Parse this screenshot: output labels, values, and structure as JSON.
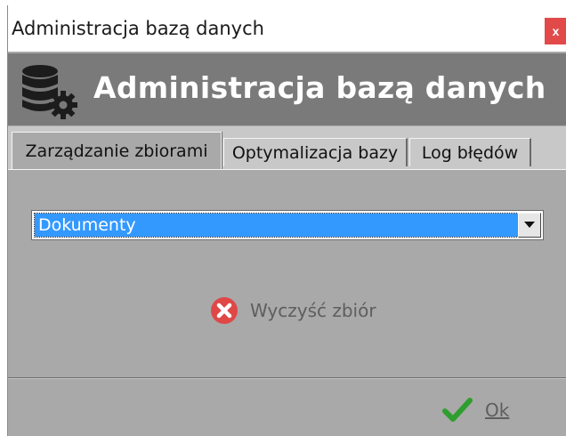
{
  "window": {
    "title": "Administracja bazą danych",
    "close_label": "x"
  },
  "header": {
    "title": "Administracja bazą danych",
    "icon": "database-settings-icon"
  },
  "tabs": [
    {
      "label": "Zarządzanie zbiorami",
      "active": true
    },
    {
      "label": "Optymalizacja bazy",
      "active": false
    },
    {
      "label": "Log błędów",
      "active": false
    }
  ],
  "dataset_select": {
    "selected": "Dokumenty"
  },
  "actions": {
    "clear_label": "Wyczyść zbiór",
    "ok_label": "Ok"
  },
  "colors": {
    "header_bg": "#7a7a7a",
    "panel_bg": "#a9a9a9",
    "selection": "#3399ff",
    "close_red": "#e24a4a",
    "ok_green": "#2e9e2e"
  }
}
